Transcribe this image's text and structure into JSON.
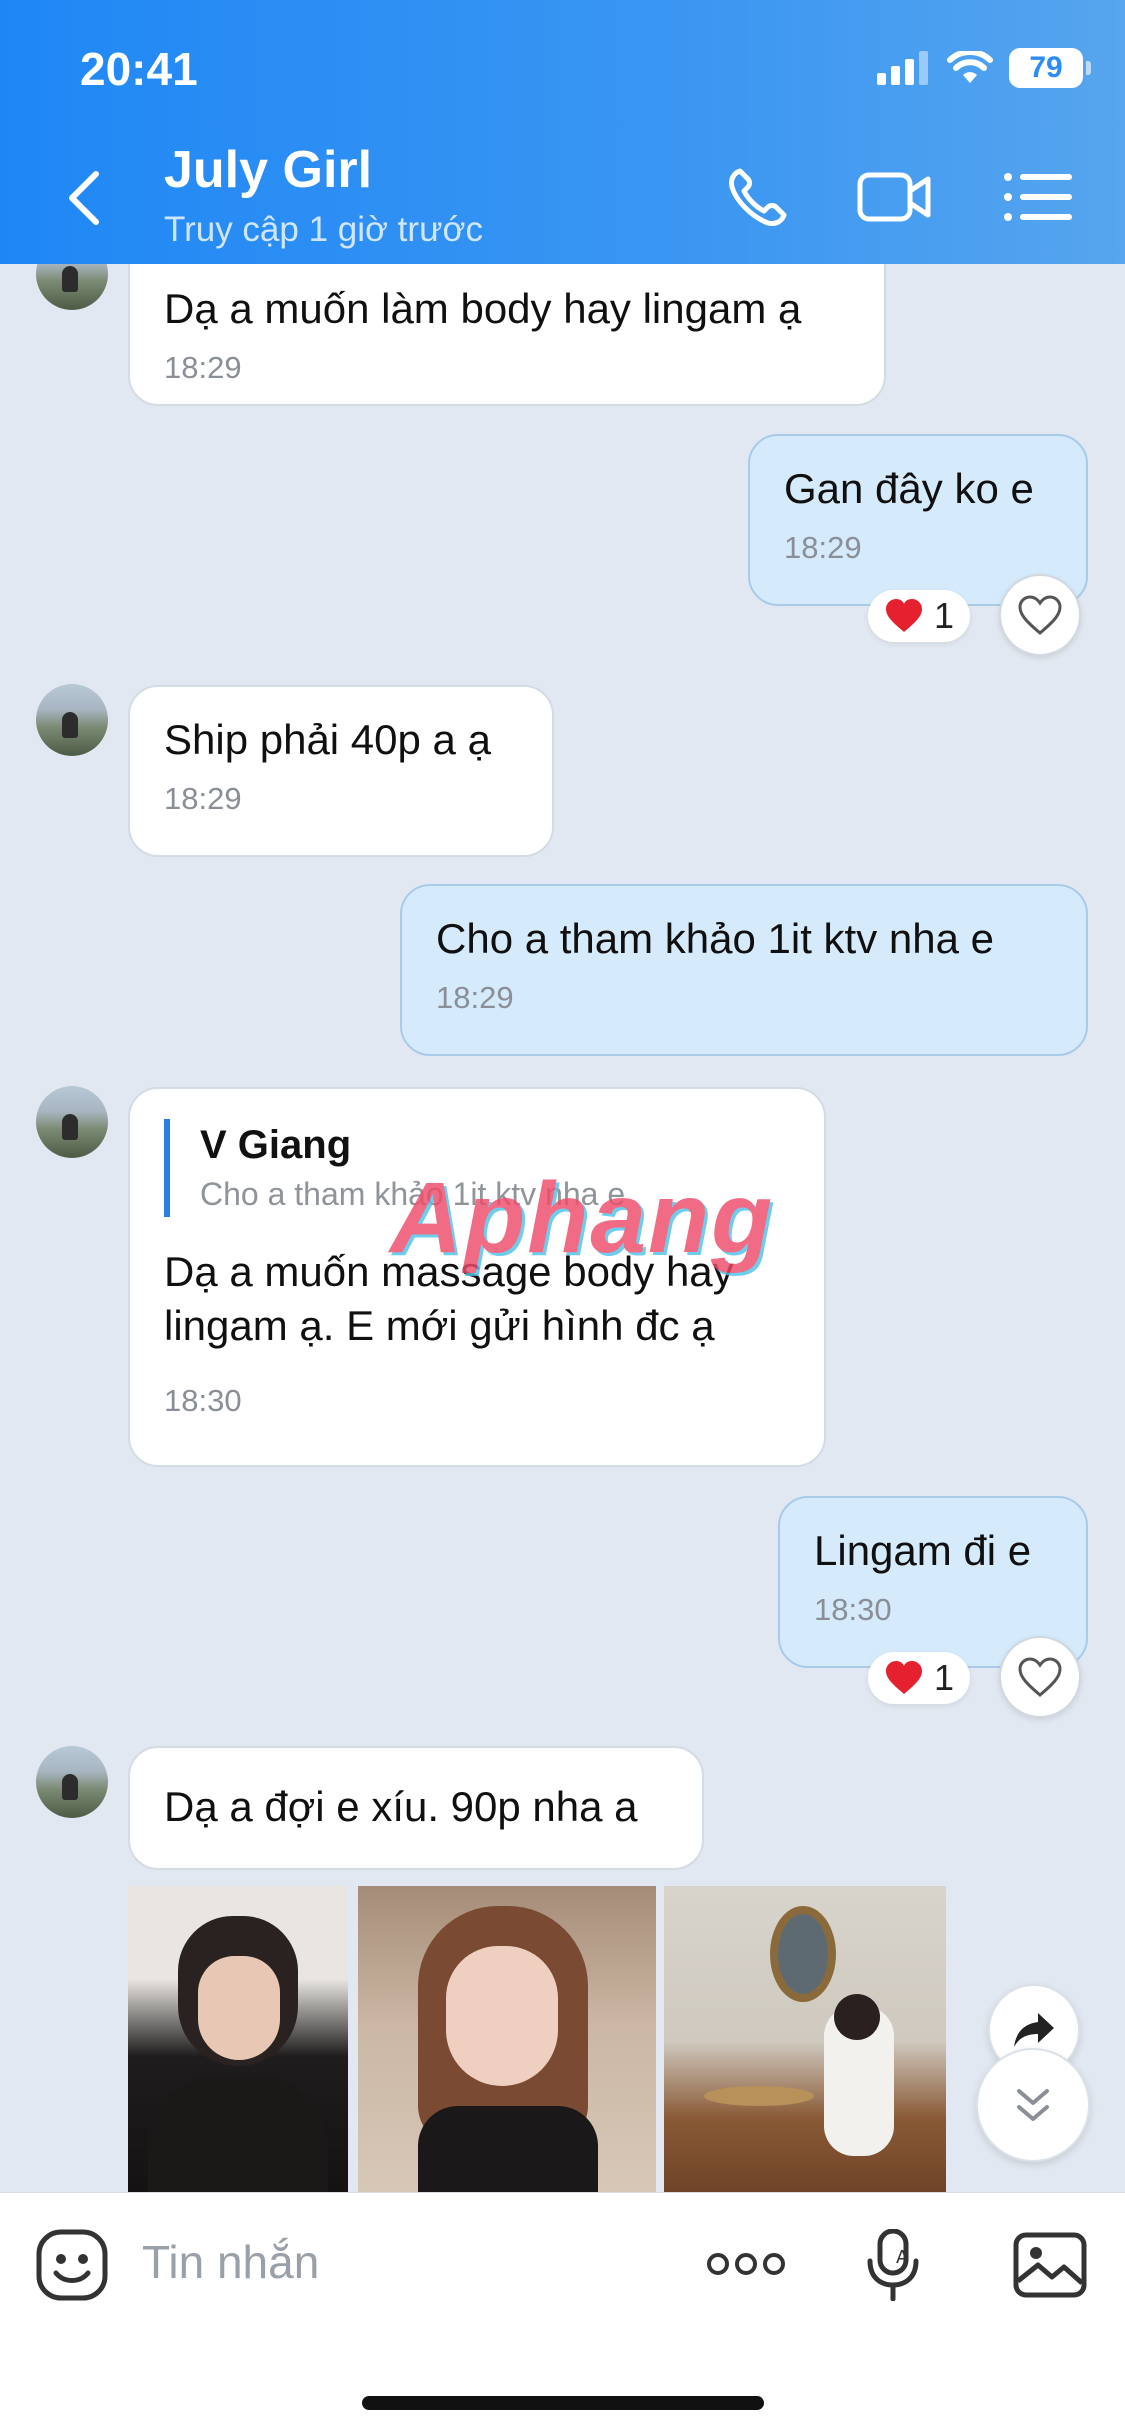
{
  "status_bar": {
    "time": "20:41",
    "battery": "79"
  },
  "header": {
    "title": "July Girl",
    "subtitle": "Truy cập 1 giờ trước"
  },
  "messages": [
    {
      "id": "m1",
      "dir": "in",
      "text": "Dạ a muốn làm body hay lingam ạ",
      "time": "18:29"
    },
    {
      "id": "m2",
      "dir": "out",
      "text": "Gan đây ko e",
      "time": "18:29",
      "reaction_count": "1"
    },
    {
      "id": "m3",
      "dir": "in",
      "text": "Ship phải 40p a ạ",
      "time": "18:29"
    },
    {
      "id": "m4",
      "dir": "out",
      "text": "Cho a tham khảo 1it  ktv nha e",
      "time": "18:29"
    },
    {
      "id": "m5",
      "dir": "in",
      "quote_name": "V Giang",
      "quote_text": "Cho a tham khảo 1it  ktv nha e",
      "text_line1": "Dạ a muốn massage body hay",
      "text_line2": "lingam ạ. E mới gửi hình đc ạ",
      "time": "18:30"
    },
    {
      "id": "m6",
      "dir": "out",
      "text": "Lingam đi e",
      "time": "18:30",
      "reaction_count": "1"
    },
    {
      "id": "m7",
      "dir": "in",
      "text": "Dạ a đợi e xíu. 90p nha a"
    }
  ],
  "watermark": "Aphang",
  "input": {
    "placeholder": "Tin nhắn"
  },
  "colors": {
    "header_start": "#1f87f5",
    "header_end": "#56a5ee",
    "outgoing_bubble": "#d5eafb",
    "incoming_bubble": "#ffffff",
    "chat_bg": "#e2e8f1"
  },
  "icons": [
    "back-icon",
    "phone-icon",
    "video-icon",
    "menu-icon",
    "heart-icon",
    "forward-icon",
    "scroll-down-icon",
    "sticker-icon",
    "more-icon",
    "voice-icon",
    "image-icon"
  ]
}
